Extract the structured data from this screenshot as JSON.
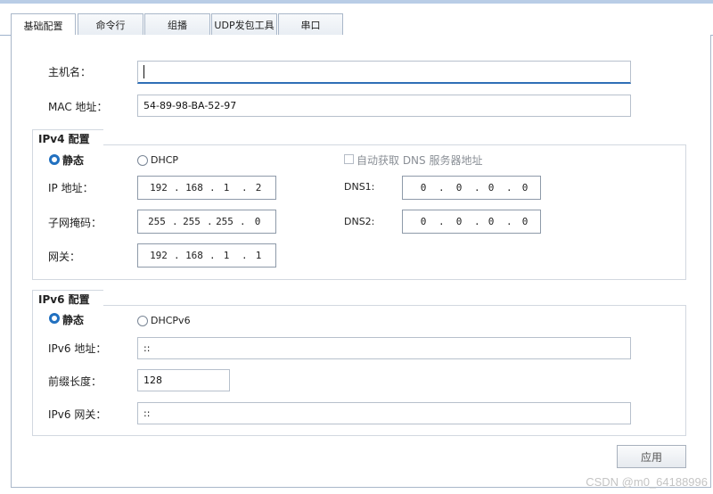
{
  "tabs": [
    {
      "label": "基础配置",
      "active": true
    },
    {
      "label": "命令行",
      "active": false
    },
    {
      "label": "组播",
      "active": false
    },
    {
      "label": "UDP发包工具",
      "active": false
    },
    {
      "label": "串口",
      "active": false
    }
  ],
  "hostname": {
    "label": "主机名：",
    "value": ""
  },
  "mac": {
    "label": "MAC 地址：",
    "value": "54-89-98-BA-52-97"
  },
  "ipv4": {
    "title": "IPv4 配置",
    "static_label": "静态",
    "static_checked": true,
    "dhcp_label": "DHCP",
    "dhcp_checked": false,
    "auto_dns_label": "自动获取 DNS 服务器地址",
    "auto_dns_checked": false,
    "ip_label": "IP 地址：",
    "ip": [
      "192",
      "168",
      "1",
      "2"
    ],
    "mask_label": "子网掩码：",
    "mask": [
      "255",
      "255",
      "255",
      "0"
    ],
    "gateway_label": "网关：",
    "gateway": [
      "192",
      "168",
      "1",
      "1"
    ],
    "dns1_label": "DNS1:",
    "dns1": [
      "0",
      "0",
      "0",
      "0"
    ],
    "dns2_label": "DNS2:",
    "dns2": [
      "0",
      "0",
      "0",
      "0"
    ]
  },
  "ipv6": {
    "title": "IPv6 配置",
    "static_label": "静态",
    "static_checked": true,
    "dhcp_label": "DHCPv6",
    "dhcp_checked": false,
    "address_label": "IPv6 地址：",
    "address": "::",
    "prefix_label": "前缀长度：",
    "prefix": "128",
    "gateway_label": "IPv6 网关：",
    "gateway": "::"
  },
  "apply_label": "应用",
  "watermark": "CSDN @m0_64188996"
}
